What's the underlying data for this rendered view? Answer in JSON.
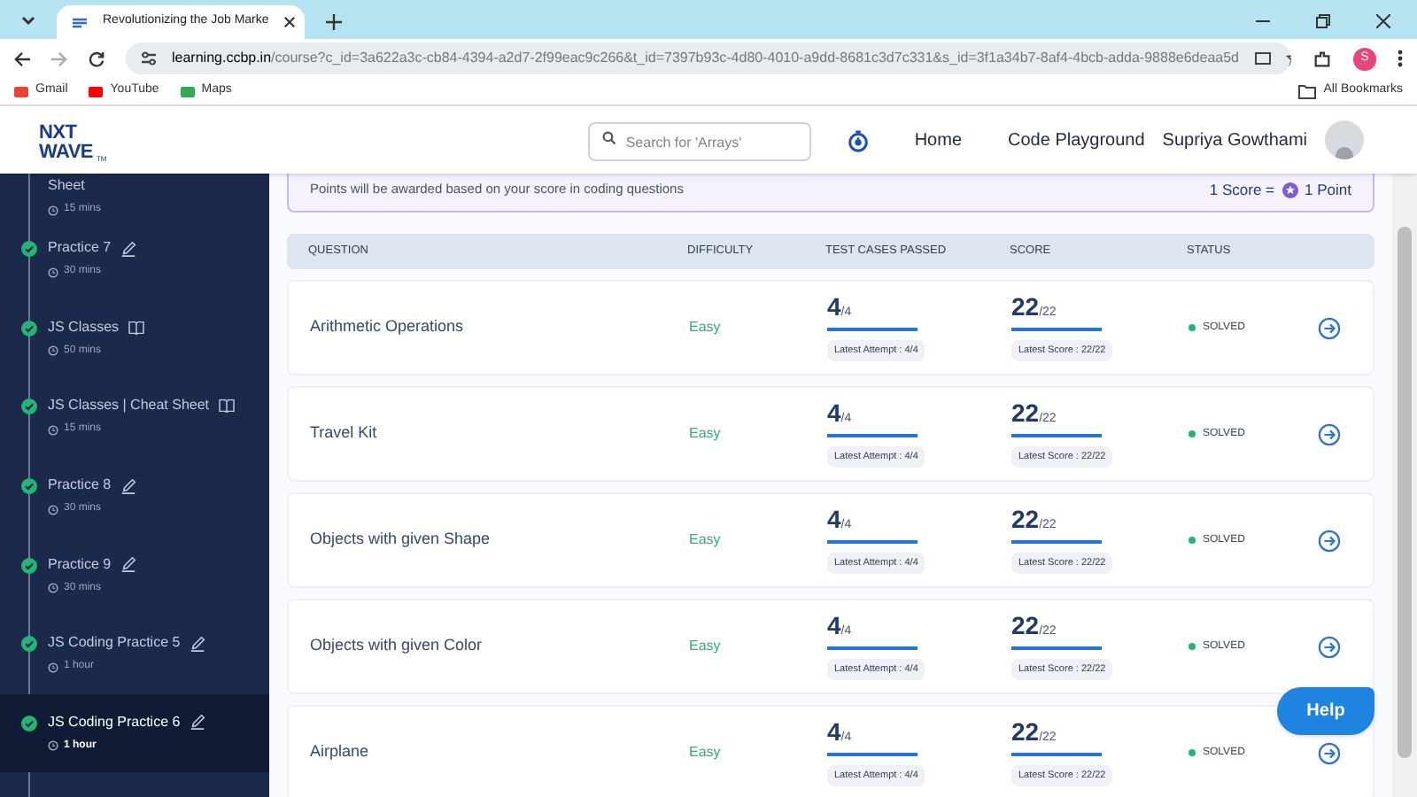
{
  "browser": {
    "tab_title": "Revolutionizing the Job Marke",
    "url_host": "learning.ccbp.in",
    "url_path": "/course?c_id=3a622a3c-cb84-4394-a2d7-2f99eac9c266&t_id=7397b93c-4d80-4010-a9dd-8681c3d7c331&s_id=3f1a34b7-8af4-4bcb-adda-9888e6deaa5d",
    "profile_initial": "S",
    "bookmarks": [
      "Gmail",
      "YouTube",
      "Maps"
    ],
    "all_bookmarks": "All Bookmarks"
  },
  "header": {
    "logo_top": "NXT",
    "logo_bottom": "WAVE",
    "logo_tm": "TM",
    "search_placeholder": "Search for 'Arrays'",
    "nav": [
      "Home",
      "Code Playground"
    ],
    "user_name": "Supriya Gowthami"
  },
  "sidebar": {
    "items": [
      {
        "title": "Sheet",
        "duration": "15 mins",
        "kind": "partial",
        "completed": false,
        "selected": false
      },
      {
        "title": "Practice 7",
        "duration": "30 mins",
        "kind": "practice",
        "completed": true,
        "selected": false
      },
      {
        "title": "JS Classes",
        "duration": "50 mins",
        "kind": "reading",
        "completed": true,
        "selected": false
      },
      {
        "title": "JS Classes | Cheat Sheet",
        "duration": "15 mins",
        "kind": "reading",
        "completed": true,
        "selected": false
      },
      {
        "title": "Practice 8",
        "duration": "30 mins",
        "kind": "practice",
        "completed": true,
        "selected": false
      },
      {
        "title": "Practice 9",
        "duration": "30 mins",
        "kind": "practice",
        "completed": true,
        "selected": false
      },
      {
        "title": "JS Coding Practice 5",
        "duration": "1 hour",
        "kind": "practice",
        "completed": true,
        "selected": false
      },
      {
        "title": "JS Coding Practice 6",
        "duration": "1 hour",
        "kind": "practice",
        "completed": true,
        "selected": true
      }
    ]
  },
  "info": {
    "text": "Points will be awarded based on your score in coding questions",
    "score_label": "1 Score =",
    "point_label": "1 Point"
  },
  "table": {
    "columns": [
      "QUESTION",
      "DIFFICULTY",
      "TEST CASES PASSED",
      "SCORE",
      "STATUS"
    ],
    "rows": [
      {
        "question": "Arithmetic Operations",
        "difficulty": "Easy",
        "passed": {
          "value": "4",
          "total": "/4",
          "level": 1,
          "latest": "Latest Attempt : 4/4"
        },
        "score": {
          "value": "22",
          "total": "/22",
          "level": 1,
          "latest": "Latest Score : 22/22"
        },
        "status": "SOLVED"
      },
      {
        "question": "Travel Kit",
        "difficulty": "Easy",
        "passed": {
          "value": "4",
          "total": "/4",
          "level": 1,
          "latest": "Latest Attempt : 4/4"
        },
        "score": {
          "value": "22",
          "total": "/22",
          "level": 1,
          "latest": "Latest Score : 22/22"
        },
        "status": "SOLVED"
      },
      {
        "question": "Objects with given Shape",
        "difficulty": "Easy",
        "passed": {
          "value": "4",
          "total": "/4",
          "level": 1,
          "latest": "Latest Attempt : 4/4"
        },
        "score": {
          "value": "22",
          "total": "/22",
          "level": 1,
          "latest": "Latest Score : 22/22"
        },
        "status": "SOLVED"
      },
      {
        "question": "Objects with given Color",
        "difficulty": "Easy",
        "passed": {
          "value": "4",
          "total": "/4",
          "level": 1,
          "latest": "Latest Attempt : 4/4"
        },
        "score": {
          "value": "22",
          "total": "/22",
          "level": 1,
          "latest": "Latest Score : 22/22"
        },
        "status": "SOLVED"
      },
      {
        "question": "Airplane",
        "difficulty": "Easy",
        "passed": {
          "value": "4",
          "total": "/4",
          "level": 1,
          "latest": "Latest Attempt : 4/4"
        },
        "score": {
          "value": "22",
          "total": "/22",
          "level": 1,
          "latest": "Latest Score : 22/22"
        },
        "status": "SOLVED"
      }
    ]
  },
  "help_button": "Help"
}
